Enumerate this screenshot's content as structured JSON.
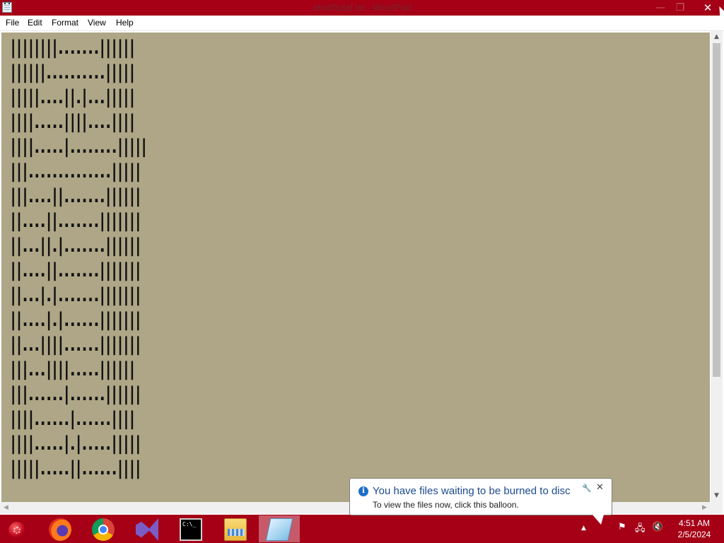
{
  "window": {
    "title": "ahsdfsdaf.txt - WordPad",
    "close_glyph": "✕",
    "min_glyph": "—",
    "max_glyph": "❐"
  },
  "menu": {
    "items": [
      "File",
      "Edit",
      "Format",
      "View",
      "Help"
    ]
  },
  "document": {
    "lines": [
      "||||||||.......||||||",
      "||||||..........|||||",
      "|||||....||.|...|||||",
      "||||.....||||....||||",
      "||||.....|........|||||",
      "|||..............|||||",
      "|||....||.......||||||",
      "||....||.......|||||||",
      "||...||.|.......||||||",
      "||....||.......|||||||",
      "||...|.|.......|||||||",
      "||....|.|......|||||||",
      "||...||||......|||||||",
      "|||...||||.....||||||",
      "|||......|......||||||",
      "||||......|......||||",
      "||||.....|.|.....|||||",
      "|||||.....||......||||"
    ]
  },
  "scrollbars": {
    "vertical": {
      "up": "▲",
      "down": "▼"
    },
    "horizontal": {
      "left": "◀",
      "right": "▶"
    }
  },
  "balloon": {
    "title": "You have files waiting to be burned to disc",
    "body": "To view the files now, click this balloon.",
    "info_glyph": "i",
    "settings_glyph": "🔧",
    "close_glyph": "✕"
  },
  "taskbar": {
    "apps": [
      {
        "name": "firefox-icon",
        "active": false
      },
      {
        "name": "chrome-icon",
        "active": false
      },
      {
        "name": "visual-studio-icon",
        "active": false
      },
      {
        "name": "command-prompt-icon",
        "active": false
      },
      {
        "name": "file-explorer-icon",
        "active": false
      },
      {
        "name": "wordpad-icon",
        "active": true
      }
    ],
    "cmd_icon_text": "C:\\_",
    "tray": {
      "chevron": "▲",
      "flag": "⚑",
      "network": "🖧",
      "volume": "🔇"
    },
    "clock": {
      "time": "4:51 AM",
      "date": "2/5/2024"
    }
  }
}
